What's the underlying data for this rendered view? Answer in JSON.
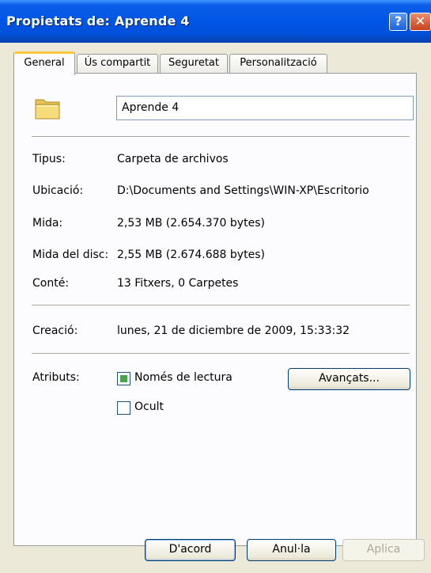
{
  "window": {
    "title": "Propietats de: Aprende 4",
    "help_glyph": "?",
    "close_glyph": "✕"
  },
  "tabs": [
    {
      "label": "General",
      "active": true
    },
    {
      "label": "Ús compartit",
      "active": false
    },
    {
      "label": "Seguretat",
      "active": false
    },
    {
      "label": "Personalització",
      "active": false
    }
  ],
  "general": {
    "icon": "folder-icon",
    "name_value": "Aprende 4",
    "props": [
      {
        "label": "Tipus:",
        "value": "Carpeta de archivos"
      },
      {
        "label": "Ubicació:",
        "value": "D:\\Documents and Settings\\WIN-XP\\Escritorio"
      },
      {
        "label": "Mida:",
        "value": "2,53 MB (2.654.370 bytes)"
      },
      {
        "label": "Mida del disc:",
        "value": "2,55 MB (2.674.688 bytes)"
      },
      {
        "label": "Conté:",
        "value": "13 Fitxers, 0 Carpetes"
      }
    ],
    "created": {
      "label": "Creació:",
      "value": "lunes, 21 de diciembre de 2009, 15:33:32"
    },
    "attributes": {
      "label": "Atributs:",
      "readonly": {
        "label": "Només de lectura",
        "checked": "indeterminate"
      },
      "hidden": {
        "label": "Ocult",
        "checked": false
      },
      "advanced_button": "Avançats..."
    }
  },
  "footer": {
    "ok": "D'acord",
    "cancel": "Anul·la",
    "apply": "Aplica"
  },
  "colors": {
    "titlebar": "#0055e5",
    "background": "#ece9d8",
    "tab_highlight": "#ffc83c"
  }
}
